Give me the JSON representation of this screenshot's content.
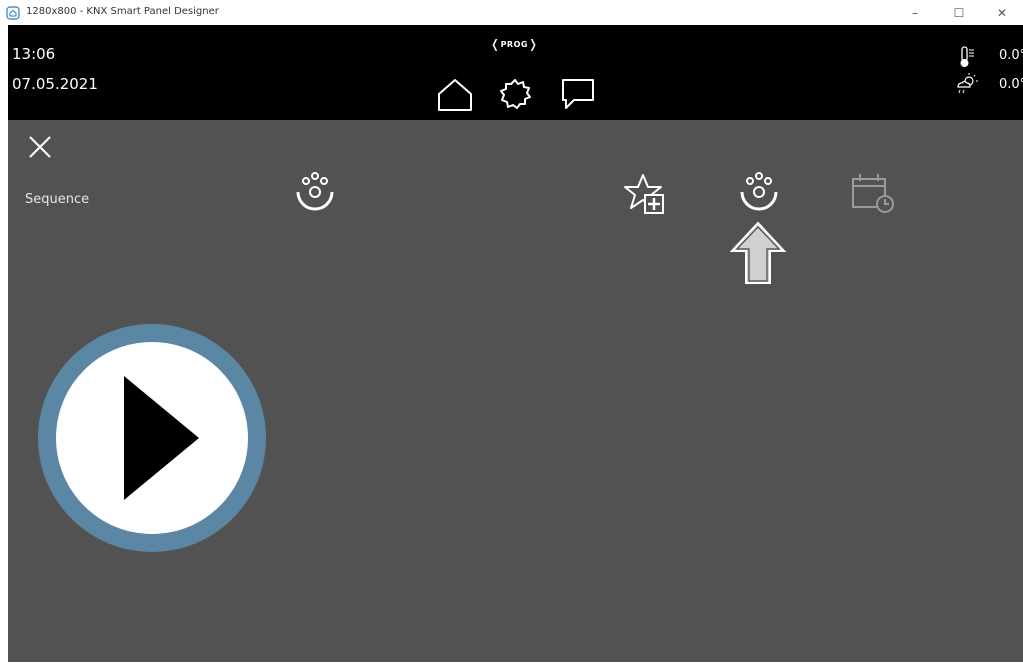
{
  "window": {
    "title": "1280x800 - KNX Smart Panel Designer",
    "controls": {
      "minimize": "–",
      "maximize": "☐",
      "close": "✕"
    }
  },
  "header": {
    "time": "13:06",
    "date": "07.05.2021",
    "prog_label": "PROG",
    "nav_icons": [
      "home-icon",
      "settings-icon",
      "message-icon"
    ],
    "temperature": "0.0°",
    "weather": "0.0°"
  },
  "content": {
    "sequence_label": "Sequence",
    "icons": [
      "scene-icon",
      "favorite-add-icon",
      "scene-icon",
      "schedule-icon"
    ]
  },
  "colors": {
    "header_bg": "#000000",
    "content_bg": "#525252",
    "play_ring": "#5b87a5",
    "icon_white": "#ffffff",
    "icon_disabled": "#9a9a9a"
  }
}
